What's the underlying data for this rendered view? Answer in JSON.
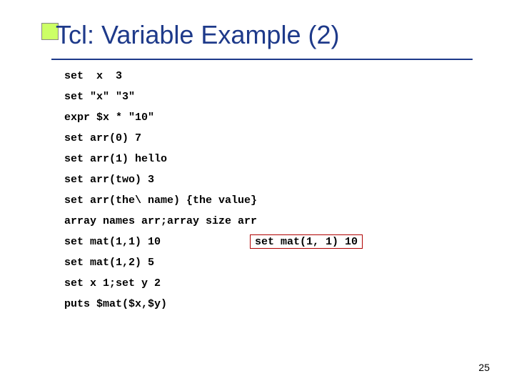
{
  "title": "Tcl: Variable Example (2)",
  "lines": {
    "l1": "set  x  3",
    "l2": "set \"x\" \"3\"",
    "l3": "expr $x * \"10\"",
    "l4": "set arr(0) 7",
    "l5": "set arr(1) hello",
    "l6": "set arr(two) 3",
    "l7": "set arr(the\\ name) {the value}",
    "l8": "array names arr;array size arr",
    "l9": "set mat(1,1) 10",
    "l10": "set mat(1,2) 5",
    "l11": "set x 1;set y 2",
    "l12": "puts $mat($x,$y)"
  },
  "boxed": "set mat(1, 1) 10",
  "page_number": "25"
}
